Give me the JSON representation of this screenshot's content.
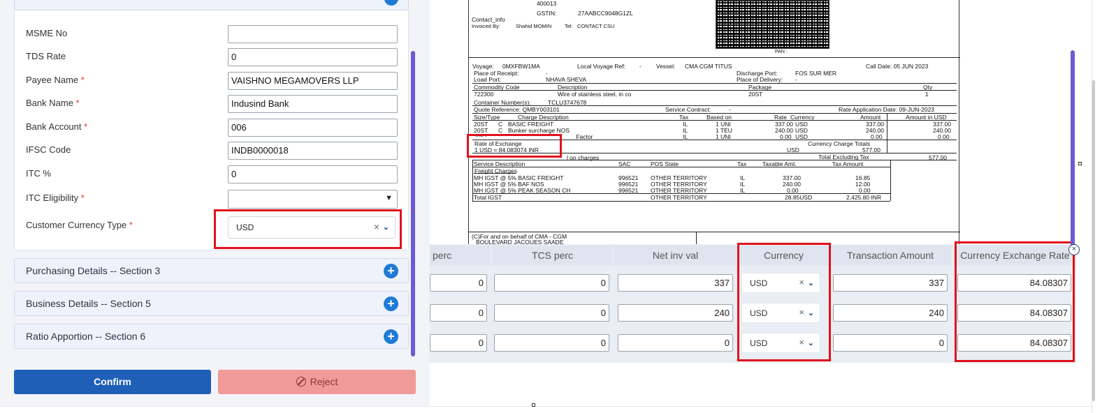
{
  "form": {
    "fields": [
      {
        "label": "MSME No",
        "required": false,
        "value": ""
      },
      {
        "label": "TDS Rate",
        "required": false,
        "value": "0"
      },
      {
        "label": "Payee Name",
        "required": true,
        "value": "VAISHNO MEGAMOVERS LLP"
      },
      {
        "label": "Bank Name",
        "required": true,
        "value": "Indusind Bank"
      },
      {
        "label": "Bank Account",
        "required": true,
        "value": "006"
      },
      {
        "label": "IFSC Code",
        "required": false,
        "value": "INDB0000018"
      },
      {
        "label": "ITC %",
        "required": false,
        "value": "0"
      }
    ],
    "itc_eligibility": {
      "label": "ITC Eligibility",
      "required": true,
      "value": ""
    },
    "customer_currency": {
      "label": "Customer Currency Type",
      "required": true,
      "value": "USD"
    },
    "required_mark": "*"
  },
  "sections": [
    {
      "title": "Purchasing Details -- Section 3"
    },
    {
      "title": "Business Details -- Section 5"
    },
    {
      "title": "Ratio Apportion -- Section 6"
    }
  ],
  "actions": {
    "confirm": "Confirm",
    "reject": "Reject"
  },
  "invoice": {
    "addr_line": "400013",
    "gstin_label": "GSTIN:",
    "gstin": "27AABCC9048G1ZL",
    "contact_info": "Contact_info",
    "invoiced_by": "Invoiced By:",
    "invoiced_by_name": "Shahid MOMIN",
    "tel": "Tel:",
    "tel_value": "CONTACT CSU",
    "pan": "PAN :",
    "voyage_label": "Voyage:",
    "voyage": "0MXFBW1MA",
    "local_voyage": "Local Voyage Ref:",
    "local_voyage_value": "-",
    "vessel_label": "Vessel:",
    "vessel": "CMA CGM TITUS",
    "call_date": "Call Date: 05 JUN 2023",
    "place_receipt": "Place of Receipt:",
    "place_receipt_value": "-",
    "discharge_port": "Discharge Port:",
    "discharge_port_value": "FOS SUR MER",
    "load_port": "Load Port:",
    "load_port_value": "NHAVA SHEVA",
    "place_delivery": "Place of Delivery:",
    "place_delivery_value": "-",
    "commodity_code": "Commodity Code",
    "description": "Description",
    "package": "Package",
    "qty": "Qty",
    "commodity_code_value": "722300",
    "description_value": "Wire of stainless steel, in co",
    "package_value": "20ST",
    "qty_value": "1",
    "container_label": "Container Number(s):",
    "container_value": "TCLU3747678",
    "quote_ref": "Quote Reference: QMBY003101",
    "service_contract": "Service Contract:",
    "service_contract_value": "-",
    "rate_app_date": "Rate Application Date: 09-JUN-2023",
    "charge_headers": [
      "Size/Type",
      "Charge Description",
      "Tax",
      "Based on",
      "Rate",
      "Currency",
      "Amount",
      "Amount in USD"
    ],
    "charges": [
      {
        "size": "20ST",
        "c": "C",
        "desc": "BASIC FREIGHT",
        "tax": "IL",
        "based": "1 UNI",
        "rate": "337.00",
        "ccy": "USD",
        "amount": "337.00",
        "usd": "337.00"
      },
      {
        "size": "20ST",
        "c": "C",
        "desc": "Bunker surcharge NOS",
        "tax": "IL",
        "based": "1 TEU",
        "rate": "240.00",
        "ccy": "USD",
        "amount": "240.00",
        "usd": "240.00"
      },
      {
        "size": "20ST",
        "c": "C",
        "desc": "Peak Season Adjustment Factor",
        "tax": "IL",
        "based": "1 UNI",
        "rate": "0.00",
        "ccy": "USD",
        "amount": "0.00",
        "usd": "0.00"
      }
    ],
    "rate_of_exchange": "Rate of Exchange",
    "rate_value": "1 USD = 84.083074 INR",
    "currency_charge_totals": "Currency Charge Totals",
    "totals_ccy": "USD",
    "totals_amount": "577.00",
    "total_excl_tax": "Total Excluding Tax",
    "total_excl_tax_value": "577.00",
    "on_charges": "l on charges",
    "tax_headers": [
      "Service Description",
      "SAC",
      "POS State",
      "Tax",
      "Taxable Amt.",
      "Tax Amount"
    ],
    "freight_charges": "Freight Charges",
    "tax_rows": [
      {
        "desc": "MH IGST @ 5% BASIC  FREIGHT",
        "sac": "996521",
        "pos": "OTHER TERRITORY",
        "tax": "IL",
        "taxable": "337.00",
        "amount": "16.85"
      },
      {
        "desc": "MH IGST @ 5% BAF NOS",
        "sac": "996521",
        "pos": "OTHER TERRITORY",
        "tax": "IL",
        "taxable": "240.00",
        "amount": "12.00"
      },
      {
        "desc": "MH IGST @ 5% PEAK SEASON CH",
        "sac": "996521",
        "pos": "OTHER TERRITORY",
        "tax": "IL",
        "taxable": "0.00",
        "amount": "0.00"
      }
    ],
    "total_igst": "Total IGST",
    "total_igst_pos": "OTHER TERRITORY",
    "total_igst_usd": "28.85USD",
    "total_igst_inr": "2,425.80 INR",
    "footer1": "(C)For and on behalf of CMA - CGM",
    "footer2": "BOULEVARD JACQUES SAADE"
  },
  "grid": {
    "headers": [
      "perc",
      "TCS perc",
      "Net inv val",
      "Currency",
      "Transaction Amount",
      "Currency Exchange Rate"
    ],
    "rows": [
      {
        "perc": "0",
        "tcs": "0",
        "net": "337",
        "currency": "USD",
        "txn": "337",
        "rate": "84.08307"
      },
      {
        "perc": "0",
        "tcs": "0",
        "net": "240",
        "currency": "USD",
        "txn": "240",
        "rate": "84.08307"
      },
      {
        "perc": "0",
        "tcs": "0",
        "net": "0",
        "currency": "USD",
        "txn": "0",
        "rate": "84.08307"
      }
    ]
  },
  "icons": {
    "clear": "×",
    "chevron": "⌄",
    "close": "×",
    "plus": "+"
  },
  "highlight_color": "#e0121c"
}
